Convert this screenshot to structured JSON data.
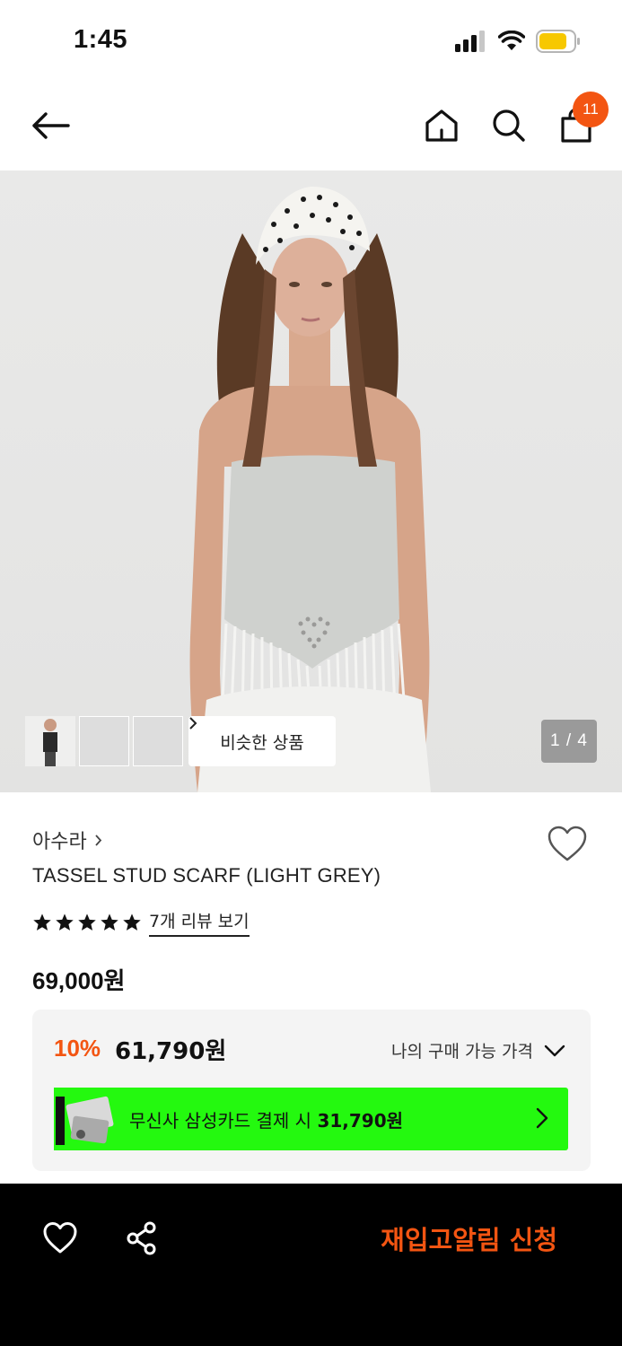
{
  "status_bar": {
    "time": "1:45"
  },
  "top_nav": {
    "cart_count": "11"
  },
  "gallery": {
    "similar_label": "비슷한 상품",
    "page_indicator": "1 / 4"
  },
  "product": {
    "brand": "아수라",
    "name": "TASSEL STUD SCARF (LIGHT GREY)",
    "rating_stars": 5,
    "review_link": "7개 리뷰 보기",
    "price": "69,000원"
  },
  "price_box": {
    "discount_rate": "10%",
    "discount_price": "61,790원",
    "my_price_label": "나의 구매 가능 가격",
    "card_text_prefix": "무신사 삼성카드 결제 시",
    "card_price": "31,790원"
  },
  "bottom_bar": {
    "restock_label": "재입고알림 신청"
  },
  "colors": {
    "accent": "#f35512",
    "card_banner": "#24f90f",
    "bottom_bar": "#000000"
  },
  "icons": [
    "back-arrow-icon",
    "home-icon",
    "search-icon",
    "shopping-bag-icon",
    "heart-icon",
    "share-icon",
    "chevron-right-icon",
    "chevron-down-icon",
    "star-icon"
  ]
}
